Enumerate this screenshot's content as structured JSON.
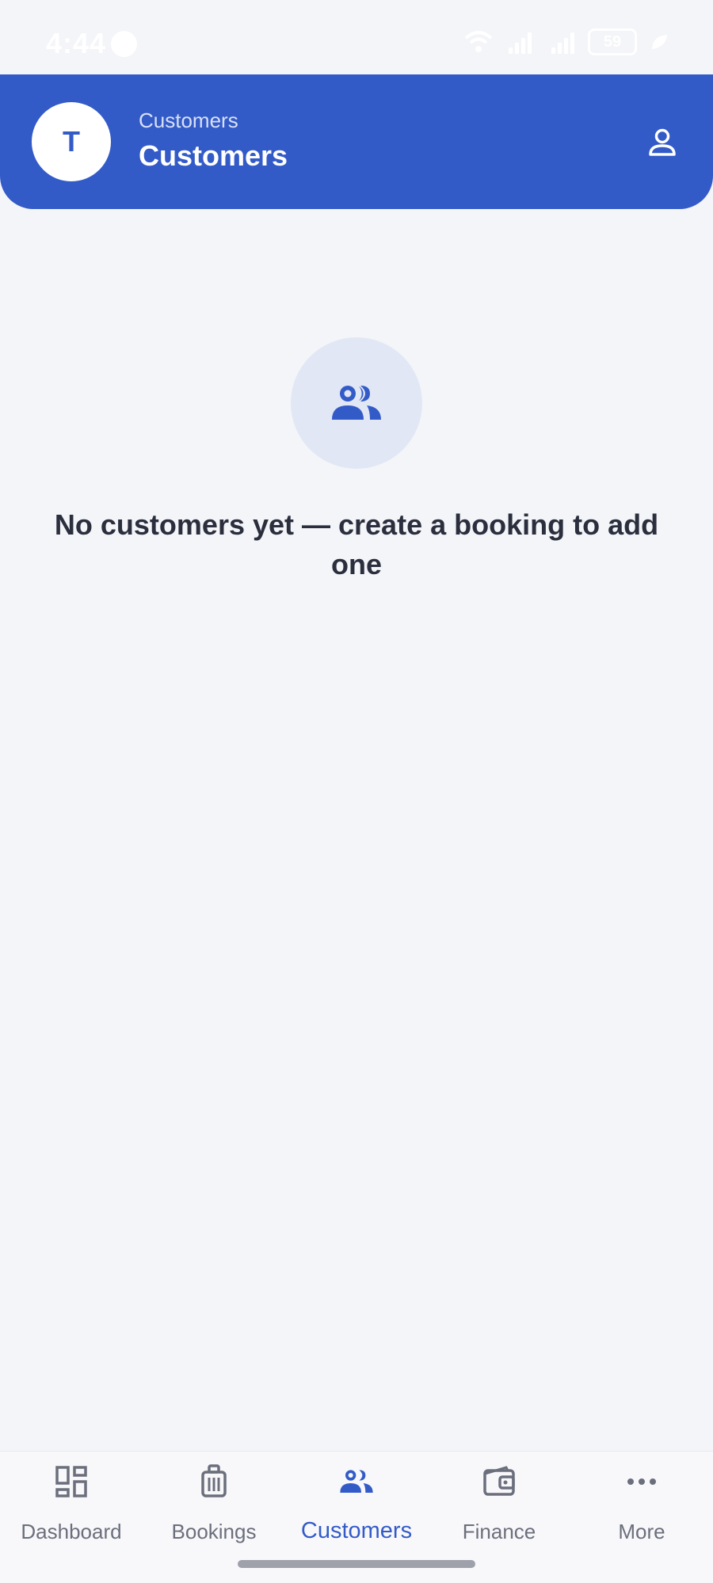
{
  "status_bar": {
    "time": "4:44",
    "battery": "59"
  },
  "header": {
    "avatar_initial": "T",
    "subtitle": "Customers",
    "title": "Customers"
  },
  "empty_state": {
    "message": "No customers yet — create a booking to add one"
  },
  "bottom_nav": {
    "items": [
      {
        "label": "Dashboard",
        "icon": "dashboard-icon",
        "active": false
      },
      {
        "label": "Bookings",
        "icon": "luggage-icon",
        "active": false
      },
      {
        "label": "Customers",
        "icon": "people-icon",
        "active": true
      },
      {
        "label": "Finance",
        "icon": "wallet-icon",
        "active": false
      },
      {
        "label": "More",
        "icon": "more-dots-icon",
        "active": false
      }
    ]
  },
  "colors": {
    "primary": "#335bc8",
    "background": "#f4f5f9",
    "text_dark": "#2b2f3d",
    "nav_inactive": "#6b6f7c"
  }
}
